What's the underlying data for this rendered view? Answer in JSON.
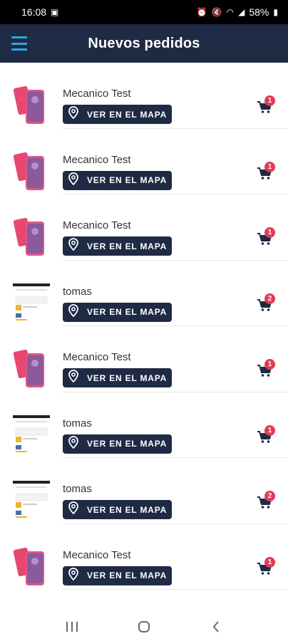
{
  "status_bar": {
    "time": "16:08",
    "battery": "58%",
    "icons": [
      "gallery-icon",
      "alarm-icon",
      "mute-icon",
      "wifi-icon",
      "signal-icon"
    ]
  },
  "app_bar": {
    "title": "Nuevos pedidos",
    "menu_icon": "menu-icon"
  },
  "orders": [
    {
      "name": "Mecanico Test",
      "button": "VER EN EL MAPA",
      "badge": "1",
      "thumb": "phone"
    },
    {
      "name": "Mecanico Test",
      "button": "VER EN EL MAPA",
      "badge": "1",
      "thumb": "phone"
    },
    {
      "name": "Mecanico Test",
      "button": "VER EN EL MAPA",
      "badge": "1",
      "thumb": "phone"
    },
    {
      "name": "tomas",
      "button": "VER EN EL MAPA",
      "badge": "2",
      "thumb": "screenshot"
    },
    {
      "name": "Mecanico Test",
      "button": "VER EN EL MAPA",
      "badge": "1",
      "thumb": "phone"
    },
    {
      "name": "tomas",
      "button": "VER EN EL MAPA",
      "badge": "1",
      "thumb": "screenshot"
    },
    {
      "name": "tomas",
      "button": "VER EN EL MAPA",
      "badge": "2",
      "thumb": "screenshot"
    },
    {
      "name": "Mecanico Test",
      "button": "VER EN EL MAPA",
      "badge": "1",
      "thumb": "phone"
    }
  ],
  "colors": {
    "primary": "#1f2a44",
    "accent": "#2aa8e0",
    "badge": "#e23a55"
  },
  "nav_bar": {
    "buttons": [
      "recents-icon",
      "home-icon",
      "back-icon"
    ]
  }
}
